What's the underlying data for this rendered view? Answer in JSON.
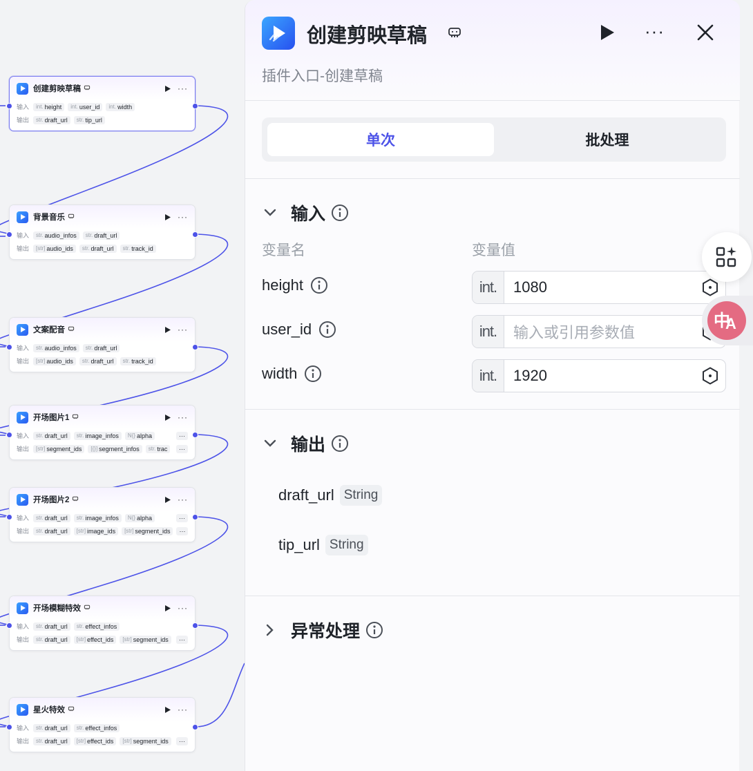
{
  "canvas": {
    "nodes": [
      {
        "title": "创建剪映草稿",
        "inputs": [
          [
            "int.",
            "height"
          ],
          [
            "int.",
            "user_id"
          ],
          [
            "int.",
            "width"
          ]
        ],
        "outputs": [
          [
            "str.",
            "draft_url"
          ],
          [
            "str.",
            "tip_url"
          ]
        ],
        "more_in": false,
        "more_out": false
      },
      {
        "title": "背景音乐",
        "inputs": [
          [
            "str.",
            "audio_infos"
          ],
          [
            "str.",
            "draft_url"
          ]
        ],
        "outputs": [
          [
            "[str]",
            "audio_ids"
          ],
          [
            "str.",
            "draft_url"
          ],
          [
            "str.",
            "track_id"
          ]
        ],
        "more_in": false,
        "more_out": false
      },
      {
        "title": "文案配音",
        "inputs": [
          [
            "str.",
            "audio_infos"
          ],
          [
            "str.",
            "draft_url"
          ]
        ],
        "outputs": [
          [
            "[str]",
            "audio_ids"
          ],
          [
            "str.",
            "draft_url"
          ],
          [
            "str.",
            "track_id"
          ]
        ],
        "more_in": false,
        "more_out": false
      },
      {
        "title": "开场图片1",
        "inputs": [
          [
            "str.",
            "draft_url"
          ],
          [
            "str.",
            "image_infos"
          ],
          [
            "N{}",
            "alpha"
          ]
        ],
        "outputs": [
          [
            "[str]",
            "segment_ids"
          ],
          [
            "[{}]",
            "segment_infos"
          ],
          [
            "str.",
            "trac"
          ]
        ],
        "more_in": true,
        "more_out": true
      },
      {
        "title": "开场图片2",
        "inputs": [
          [
            "str.",
            "draft_url"
          ],
          [
            "str.",
            "image_infos"
          ],
          [
            "N{}",
            "alpha"
          ]
        ],
        "outputs": [
          [
            "str.",
            "draft_url"
          ],
          [
            "[str]",
            "image_ids"
          ],
          [
            "[str]",
            "segment_ids"
          ]
        ],
        "more_in": true,
        "more_out": true
      },
      {
        "title": "开场模糊特效",
        "inputs": [
          [
            "str.",
            "draft_url"
          ],
          [
            "str.",
            "effect_infos"
          ]
        ],
        "outputs": [
          [
            "str.",
            "draft_url"
          ],
          [
            "[str]",
            "effect_ids"
          ],
          [
            "[str]",
            "segment_ids"
          ]
        ],
        "more_in": false,
        "more_out": true
      },
      {
        "title": "星火特效",
        "inputs": [
          [
            "str.",
            "draft_url"
          ],
          [
            "str.",
            "effect_infos"
          ]
        ],
        "outputs": [
          [
            "str.",
            "draft_url"
          ],
          [
            "[str]",
            "effect_ids"
          ],
          [
            "[str]",
            "segment_ids"
          ]
        ],
        "more_in": false,
        "more_out": true
      }
    ],
    "input_label": "输入",
    "output_label": "输出",
    "more": "···"
  },
  "panel": {
    "title": "创建剪映草稿",
    "description": "插件入口-创建草稿",
    "modes": [
      "单次",
      "批处理"
    ],
    "active_mode": "单次",
    "input_section": {
      "title": "输入",
      "col_name": "变量名",
      "col_value": "变量值",
      "vars": [
        {
          "name": "height",
          "type": "int.",
          "value": "1080",
          "placeholder": ""
        },
        {
          "name": "user_id",
          "type": "int.",
          "value": "",
          "placeholder": "输入或引用参数值"
        },
        {
          "name": "width",
          "type": "int.",
          "value": "1920",
          "placeholder": ""
        }
      ]
    },
    "output_section": {
      "title": "输出",
      "outputs": [
        {
          "name": "draft_url",
          "type": "String"
        },
        {
          "name": "tip_url",
          "type": "String"
        }
      ]
    },
    "error_section": {
      "title": "异常处理"
    }
  },
  "colors": {
    "accent": "#4d53e8",
    "edge": "#4d53e8",
    "translate": "#e46b82"
  }
}
